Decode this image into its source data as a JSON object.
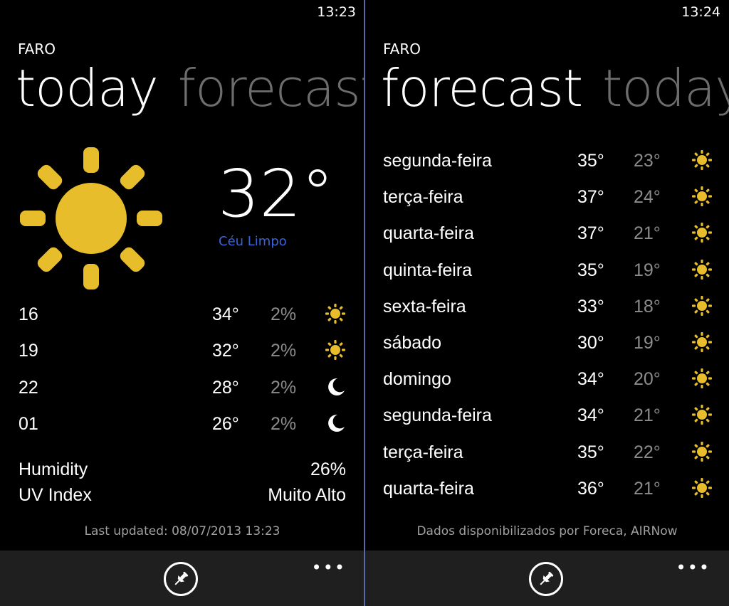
{
  "colors": {
    "sun": "#e7bd2b",
    "accent": "#3b63d9",
    "inactive_pivot": "#6d6d6d",
    "appbar": "#1f1f1f"
  },
  "left": {
    "clock": "13:23",
    "city": "FARO",
    "pivot": {
      "active": "today",
      "inactive": "forecast"
    },
    "current": {
      "temp": "32°",
      "condition": "Céu Limpo",
      "icon": "sun-icon"
    },
    "hourly": [
      {
        "hour": "16",
        "temp": "34°",
        "precip": "2%",
        "icon": "sun-icon"
      },
      {
        "hour": "19",
        "temp": "32°",
        "precip": "2%",
        "icon": "sun-icon"
      },
      {
        "hour": "22",
        "temp": "28°",
        "precip": "2%",
        "icon": "moon-icon"
      },
      {
        "hour": "01",
        "temp": "26°",
        "precip": "2%",
        "icon": "moon-icon"
      }
    ],
    "humidity": {
      "label": "Humidity",
      "value": "26%"
    },
    "uv": {
      "label": "UV Index",
      "value": "Muito Alto"
    },
    "footnote": "Last updated: 08/07/2013 13:23",
    "appbar": {
      "more": "•••",
      "pin_icon": "pin-icon"
    }
  },
  "right": {
    "clock": "13:24",
    "city": "FARO",
    "pivot": {
      "active": "forecast",
      "inactive": "today"
    },
    "days": [
      {
        "day": "segunda-feira",
        "high": "35°",
        "low": "23°",
        "icon": "sun-icon"
      },
      {
        "day": "terça-feira",
        "high": "37°",
        "low": "24°",
        "icon": "sun-icon"
      },
      {
        "day": "quarta-feira",
        "high": "37°",
        "low": "21°",
        "icon": "sun-icon"
      },
      {
        "day": "quinta-feira",
        "high": "35°",
        "low": "19°",
        "icon": "sun-icon"
      },
      {
        "day": "sexta-feira",
        "high": "33°",
        "low": "18°",
        "icon": "sun-icon"
      },
      {
        "day": "sábado",
        "high": "30°",
        "low": "19°",
        "icon": "sun-icon"
      },
      {
        "day": "domingo",
        "high": "34°",
        "low": "20°",
        "icon": "sun-icon"
      },
      {
        "day": "segunda-feira",
        "high": "34°",
        "low": "21°",
        "icon": "sun-icon"
      },
      {
        "day": "terça-feira",
        "high": "35°",
        "low": "22°",
        "icon": "sun-icon"
      },
      {
        "day": "quarta-feira",
        "high": "36°",
        "low": "21°",
        "icon": "sun-icon"
      }
    ],
    "footnote": "Dados disponibilizados por Foreca, AIRNow",
    "appbar": {
      "more": "•••",
      "pin_icon": "pin-icon"
    }
  }
}
